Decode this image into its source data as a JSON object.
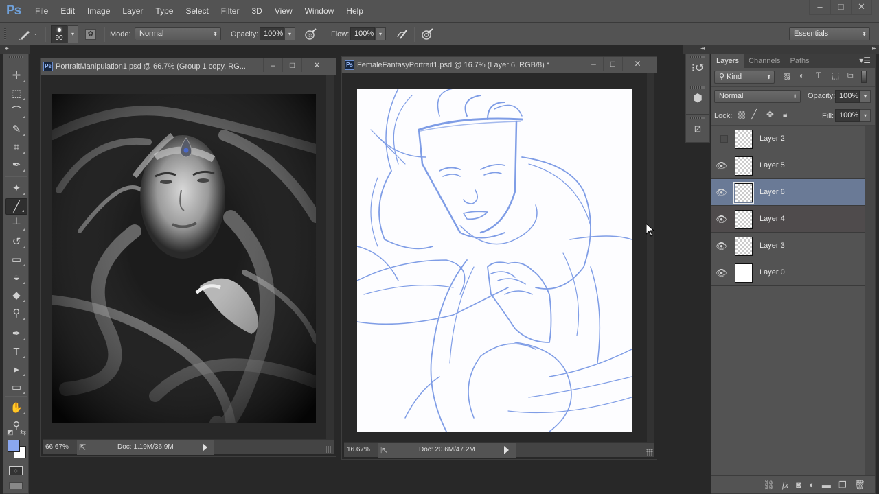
{
  "app": {
    "logo": "Ps",
    "menu": [
      "File",
      "Edit",
      "Image",
      "Layer",
      "Type",
      "Select",
      "Filter",
      "3D",
      "View",
      "Window",
      "Help"
    ],
    "window_controls": {
      "minimize": "–",
      "maximize": "□",
      "close": "✕"
    }
  },
  "options_bar": {
    "brush_size": "90",
    "mode_label": "Mode:",
    "mode_value": "Normal",
    "opacity_label": "Opacity:",
    "opacity_value": "100%",
    "flow_label": "Flow:",
    "flow_value": "100%",
    "workspace": "Essentials"
  },
  "tools": [
    {
      "name": "move-tool",
      "glyph": "✛"
    },
    {
      "name": "marquee-tool",
      "glyph": "⬚"
    },
    {
      "name": "lasso-tool",
      "glyph": "⌒"
    },
    {
      "name": "quick-selection-tool",
      "glyph": "✎"
    },
    {
      "name": "crop-tool",
      "glyph": "⌗"
    },
    {
      "name": "eyedropper-tool",
      "glyph": "✒"
    },
    {
      "name": "healing-brush-tool",
      "glyph": "✦"
    },
    {
      "name": "brush-tool",
      "glyph": "╱",
      "active": true
    },
    {
      "name": "clone-stamp-tool",
      "glyph": "┴"
    },
    {
      "name": "history-brush-tool",
      "glyph": "↺"
    },
    {
      "name": "eraser-tool",
      "glyph": "▭"
    },
    {
      "name": "paint-bucket-tool",
      "glyph": "◒"
    },
    {
      "name": "blur-tool",
      "glyph": "◆"
    },
    {
      "name": "dodge-tool",
      "glyph": "⚲"
    },
    {
      "name": "pen-tool",
      "glyph": "✒"
    },
    {
      "name": "type-tool",
      "glyph": "T"
    },
    {
      "name": "path-selection-tool",
      "glyph": "▸"
    },
    {
      "name": "rectangle-tool",
      "glyph": "▭"
    },
    {
      "name": "hand-tool",
      "glyph": "✋"
    },
    {
      "name": "zoom-tool",
      "glyph": "⚲"
    }
  ],
  "colors": {
    "foreground": "#8aa7f0",
    "background": "#ffffff",
    "sketch_stroke": "#7f9de6",
    "selected_layer": "#6a7a96"
  },
  "documents": [
    {
      "title": "PortraitManipulation1.psd @ 66.7% (Group 1 copy, RG...",
      "zoom": "66.67%",
      "doc_info": "Doc: 1.19M/36.9M"
    },
    {
      "title": "FemaleFantasyPortrait1.psd @ 16.7% (Layer 6, RGB/8) *",
      "zoom": "16.67%",
      "doc_info": "Doc: 20.6M/47.2M"
    }
  ],
  "layers_panel": {
    "tabs": [
      "Layers",
      "Channels",
      "Paths"
    ],
    "active_tab": "Layers",
    "filter_kind": "Kind",
    "blend_mode": "Normal",
    "opacity_label": "Opacity:",
    "opacity_value": "100%",
    "lock_label": "Lock:",
    "fill_label": "Fill:",
    "fill_value": "100%",
    "layers": [
      {
        "name": "Layer 2",
        "visible": false,
        "thumb": "transparent"
      },
      {
        "name": "Layer 5",
        "visible": true,
        "thumb": "transparent"
      },
      {
        "name": "Layer 6",
        "visible": true,
        "thumb": "transparent",
        "selected": true
      },
      {
        "name": "Layer 4",
        "visible": true,
        "thumb": "transparent"
      },
      {
        "name": "Layer 3",
        "visible": true,
        "thumb": "transparent"
      },
      {
        "name": "Layer 0",
        "visible": true,
        "thumb": "white"
      }
    ]
  }
}
